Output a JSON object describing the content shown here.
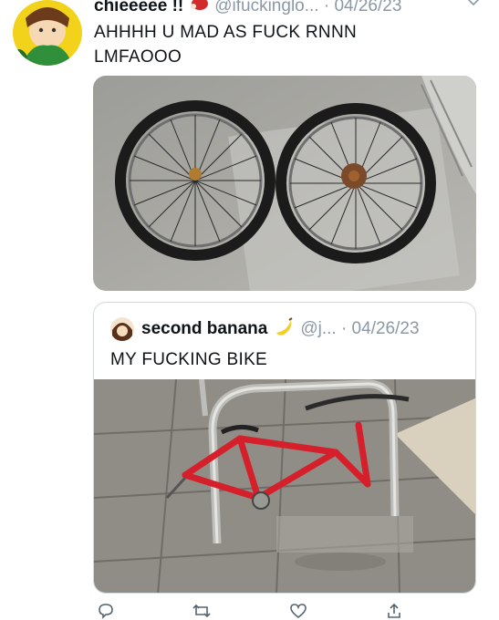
{
  "tweet": {
    "display_name": "chieeeee !!",
    "handle_time": "@ifuckinglo... · 04/26/23",
    "text": "AHHHH U MAD AS FUCK RNNN LMFAOOO"
  },
  "quote": {
    "display_name": "second banana",
    "handle_time": "@j... · 04/26/23",
    "text": "MY FUCKING BIKE"
  },
  "icons": {
    "more": "chevron-down-icon",
    "reply": "reply-icon",
    "retweet": "retweet-icon",
    "like": "like-icon",
    "share": "share-icon"
  }
}
